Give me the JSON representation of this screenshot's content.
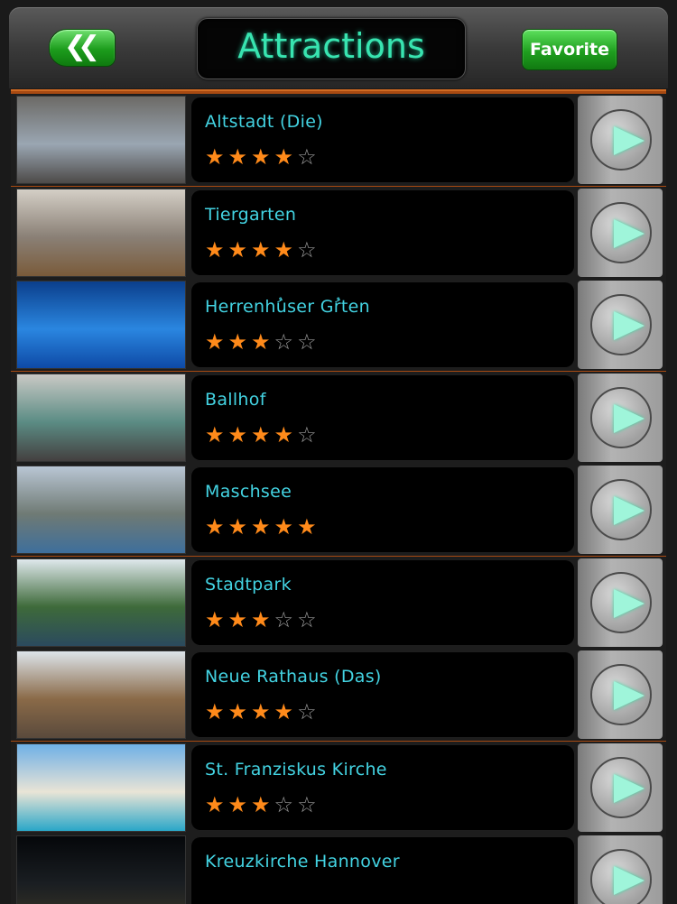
{
  "header": {
    "title": "Attractions",
    "back_label": "«",
    "favorite_label": "Favorite"
  },
  "attractions": [
    {
      "name": "Altstadt (Die)",
      "rating": 4,
      "max": 5,
      "thumb": [
        "#6c6a66",
        "#9aa6b2",
        "#4d4a48"
      ]
    },
    {
      "name": "Tiergarten",
      "rating": 4,
      "max": 5,
      "thumb": [
        "#d4cfc6",
        "#8a8076",
        "#7a5b3a"
      ]
    },
    {
      "name": "Herrenhُuser Gُrten",
      "rating": 3,
      "max": 5,
      "thumb": [
        "#0b3f8c",
        "#2a86e0",
        "#0e4aa6"
      ]
    },
    {
      "name": "Ballhof",
      "rating": 4,
      "max": 5,
      "thumb": [
        "#c9c9c5",
        "#5b8c84",
        "#444040"
      ]
    },
    {
      "name": "Maschsee",
      "rating": 5,
      "max": 5,
      "thumb": [
        "#b9c6d4",
        "#6f7a74",
        "#3e6f9c"
      ]
    },
    {
      "name": "Stadtpark",
      "rating": 3,
      "max": 5,
      "thumb": [
        "#dfe8ec",
        "#3e6a3a",
        "#2b4a5e"
      ]
    },
    {
      "name": "Neue Rathaus (Das)",
      "rating": 4,
      "max": 5,
      "thumb": [
        "#dde4ea",
        "#8a6a48",
        "#5a4a3c"
      ]
    },
    {
      "name": "St. Franziskus Kirche",
      "rating": 3,
      "max": 5,
      "thumb": [
        "#6fb0e6",
        "#e9e4d6",
        "#2aa7c8"
      ]
    },
    {
      "name": "Kreuzkirche Hannover",
      "rating": 0,
      "max": 5,
      "thumb": [
        "#05070a",
        "#1a1e22",
        "#3a3526"
      ]
    }
  ],
  "icons": {
    "back": "double-chevron-left-icon",
    "go": "play-arrow-icon",
    "star_filled": "star-filled-icon",
    "star_empty": "star-empty-icon"
  },
  "colors": {
    "title_text": "#38e4b0",
    "name_text": "#43d3e2",
    "star_filled": "#ff8a1a",
    "star_empty": "#9a9a9a",
    "frame": "#a84a12",
    "button_green": "#1f9f1f"
  }
}
